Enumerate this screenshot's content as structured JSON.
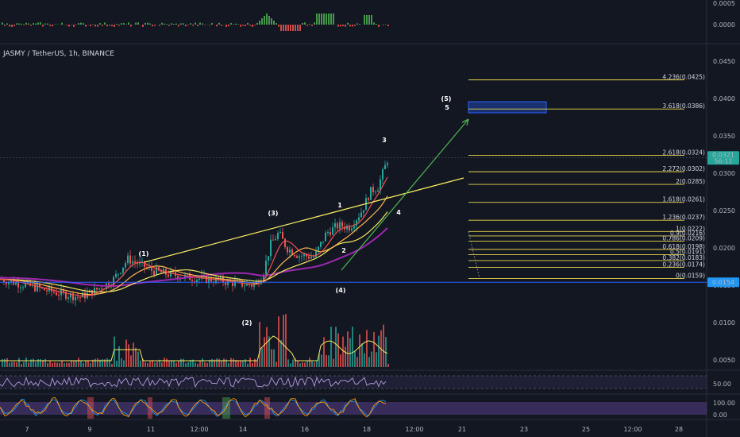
{
  "symbol_title": "JASMY / TetherUS, 1h, BINANCE",
  "top_osc_ticks": [
    "0.0005",
    "0.0000"
  ],
  "price_ticks": [
    "0.0450",
    "0.0400",
    "0.0350",
    "0.0300",
    "0.0250",
    "0.0200",
    "0.0150",
    "0.0100",
    "0.0050"
  ],
  "rsi_ticks": [
    "50.00"
  ],
  "stoch_ticks": [
    "100.00",
    "0.00"
  ],
  "time_ticks": [
    "7",
    "9",
    "11",
    "12:00",
    "14",
    "16",
    "18",
    "12:00",
    "21",
    "23",
    "25",
    "12:00",
    "28"
  ],
  "current_price": {
    "value": "0.0321",
    "countdown": "56:12",
    "color": "#26a69a"
  },
  "base_price": {
    "value": "0.0154",
    "color": "#2196f3"
  },
  "fib_levels": [
    {
      "label": "4.236(0.0425)",
      "price": 0.0425
    },
    {
      "label": "3.618(0.0386)",
      "price": 0.0386
    },
    {
      "label": "2.618(0.0324)",
      "price": 0.0324
    },
    {
      "label": "2.272(0.0302)",
      "price": 0.0302
    },
    {
      "label": "2(0.0285)",
      "price": 0.0285
    },
    {
      "label": "1.618(0.0261)",
      "price": 0.0261
    },
    {
      "label": "1.236(0.0237)",
      "price": 0.0237
    },
    {
      "label": "1(0.0222)",
      "price": 0.0222
    },
    {
      "label": "0.9(0.0216)",
      "price": 0.0216
    },
    {
      "label": "0.786(0.0209)",
      "price": 0.0209
    },
    {
      "label": "0.618(0.0198)",
      "price": 0.0198
    },
    {
      "label": "0.5(0.0191)",
      "price": 0.0191
    },
    {
      "label": "0.382(0.0183)",
      "price": 0.0183
    },
    {
      "label": "0.236(0.0174)",
      "price": 0.0174
    },
    {
      "label": "0(0.0159)",
      "price": 0.0159
    }
  ],
  "wave_labels": [
    "(1)",
    "(2)",
    "(3)",
    "(4)",
    "(5)",
    "5",
    "1",
    "2",
    "3",
    "4"
  ],
  "colors": {
    "background": "#131722",
    "fib": "#e8d44d",
    "up": "#26a69a",
    "down": "#ef5350",
    "ma_purple": "#9c27b0",
    "trendline": "#f5e960",
    "arrow": "#4caf50",
    "box": "#2962ff"
  }
}
